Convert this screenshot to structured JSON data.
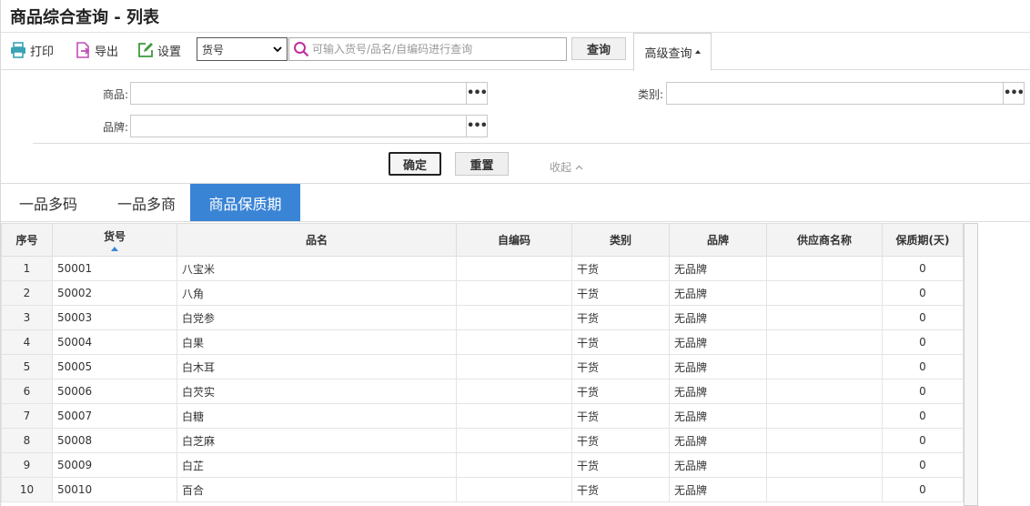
{
  "page": {
    "title": "商品综合查询 - 列表"
  },
  "toolbar": {
    "print_label": "打印",
    "export_label": "导出",
    "settings_label": "设置",
    "search_field_selected": "货号",
    "search_placeholder": "可输入货号/品名/自编码进行查询",
    "query_label": "查询",
    "advanced_label": "高级查询"
  },
  "advanced": {
    "product_label": "商品:",
    "category_label": "类别:",
    "brand_label": "品牌:",
    "more_glyph": "•••",
    "confirm_label": "确定",
    "reset_label": "重置",
    "collapse_label": "收起"
  },
  "tabs": [
    "一品多码",
    "一品多商",
    "商品保质期"
  ],
  "active_tab": 2,
  "table": {
    "headers": [
      "序号",
      "货号",
      "品名",
      "自编码",
      "类别",
      "品牌",
      "供应商名称",
      "保质期(天)"
    ],
    "rows": [
      [
        "1",
        "50001",
        "八宝米",
        "",
        "干货",
        "无品牌",
        "",
        "0"
      ],
      [
        "2",
        "50002",
        "八角",
        "",
        "干货",
        "无品牌",
        "",
        "0"
      ],
      [
        "3",
        "50003",
        "白党参",
        "",
        "干货",
        "无品牌",
        "",
        "0"
      ],
      [
        "4",
        "50004",
        "白果",
        "",
        "干货",
        "无品牌",
        "",
        "0"
      ],
      [
        "5",
        "50005",
        "白木耳",
        "",
        "干货",
        "无品牌",
        "",
        "0"
      ],
      [
        "6",
        "50006",
        "白芡实",
        "",
        "干货",
        "无品牌",
        "",
        "0"
      ],
      [
        "7",
        "50007",
        "白糖",
        "",
        "干货",
        "无品牌",
        "",
        "0"
      ],
      [
        "8",
        "50008",
        "白芝麻",
        "",
        "干货",
        "无品牌",
        "",
        "0"
      ],
      [
        "9",
        "50009",
        "白芷",
        "",
        "干货",
        "无品牌",
        "",
        "0"
      ],
      [
        "10",
        "50010",
        "百合",
        "",
        "干货",
        "无品牌",
        "",
        "0"
      ]
    ]
  },
  "colors": {
    "accent": "#3a84d6",
    "print_icon": "#3aa3b5",
    "export_icon": "#c04fb5",
    "settings_icon": "#3d9a3d",
    "search_icon": "#c02f9c"
  }
}
